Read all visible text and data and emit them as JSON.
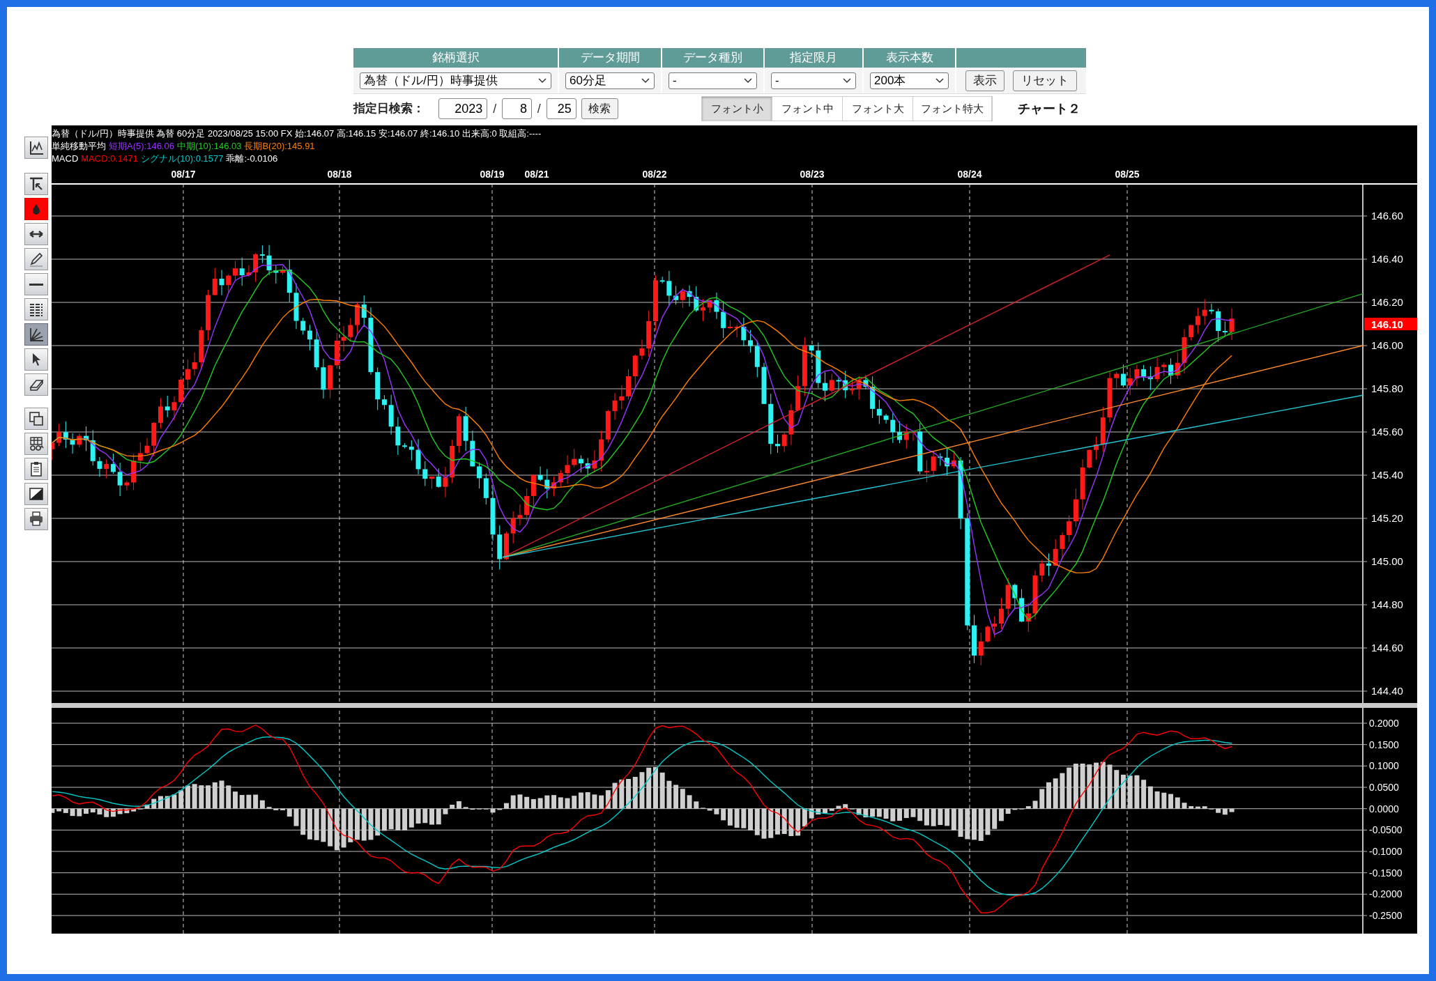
{
  "form": {
    "headers": [
      "銘柄選択",
      "データ期間",
      "データ種別",
      "指定限月",
      "表示本数"
    ],
    "selects": [
      "為替（ドル/円）時事提供",
      "60分足",
      "-",
      "-",
      "200本"
    ],
    "buttons": [
      "表示",
      "リセット"
    ]
  },
  "date_search": {
    "label": "指定日検索：",
    "year": "2023",
    "month": "8",
    "day": "25",
    "separator": "/",
    "button": "検索"
  },
  "font_tabs": [
    {
      "label": "フォント小",
      "selected": true
    },
    {
      "label": "フォント中",
      "selected": false
    },
    {
      "label": "フォント大",
      "selected": false
    },
    {
      "label": "フォント特大",
      "selected": false
    }
  ],
  "chart_title": "チャート２",
  "toolbar_groups": [
    {
      "tools": [
        {
          "kind": "chart-type",
          "selected": false
        }
      ]
    },
    {
      "tools": [
        {
          "kind": "cursor",
          "selected": false
        },
        {
          "kind": "color",
          "selected": false
        },
        {
          "kind": "arrow-line",
          "selected": false
        },
        {
          "kind": "pen",
          "selected": false
        },
        {
          "kind": "h-line",
          "selected": false
        },
        {
          "kind": "multi-line",
          "selected": false
        },
        {
          "kind": "fan",
          "selected": true
        },
        {
          "kind": "pointer",
          "selected": false
        },
        {
          "kind": "eraser",
          "selected": false
        }
      ]
    },
    {
      "tools": [
        {
          "kind": "copy",
          "selected": false
        },
        {
          "kind": "table",
          "selected": false
        },
        {
          "kind": "clipboard",
          "selected": false
        },
        {
          "kind": "contrast",
          "selected": false
        },
        {
          "kind": "print",
          "selected": false
        }
      ]
    }
  ],
  "chart": {
    "info_line": "為替（ドル/円）時事提供 為替 60分足 2023/08/25 15:00 FX 始:146.07 高:146.15 安:146.07 終:146.10 出来高:0 取組高:----",
    "ma_legend": {
      "label": "単純移動平均",
      "items": [
        {
          "text": "短期A(5):146.06",
          "color": "#9933ff"
        },
        {
          "text": "中期(10):146.03",
          "color": "#22cc22"
        },
        {
          "text": "長期B(20):145.91",
          "color": "#ff7f00"
        }
      ]
    },
    "macd_legend": {
      "label": "MACD",
      "items": [
        {
          "text": "MACD:0.1471",
          "color": "#ff0000"
        },
        {
          "text": "シグナル(10):0.1577",
          "color": "#00cccc"
        },
        {
          "text": "乖離:-0.0106",
          "color": "#ffffff"
        }
      ]
    },
    "dates": [
      "08/17",
      "08/18",
      "08/19",
      "08/21",
      "08/22",
      "08/23",
      "08/24",
      "08/25"
    ],
    "price_ticks": [
      "146.60",
      "146.40",
      "146.20",
      "146.00",
      "145.80",
      "145.60",
      "145.40",
      "145.20",
      "145.00",
      "144.80",
      "144.60",
      "144.40"
    ],
    "last_price": "146.10",
    "macd_ticks": [
      "0.2000",
      "0.1500",
      "0.1000",
      "0.0500",
      "0.0000",
      "-0.0500",
      "-0.1000",
      "-0.1500",
      "-0.2000",
      "-0.2500"
    ]
  }
}
